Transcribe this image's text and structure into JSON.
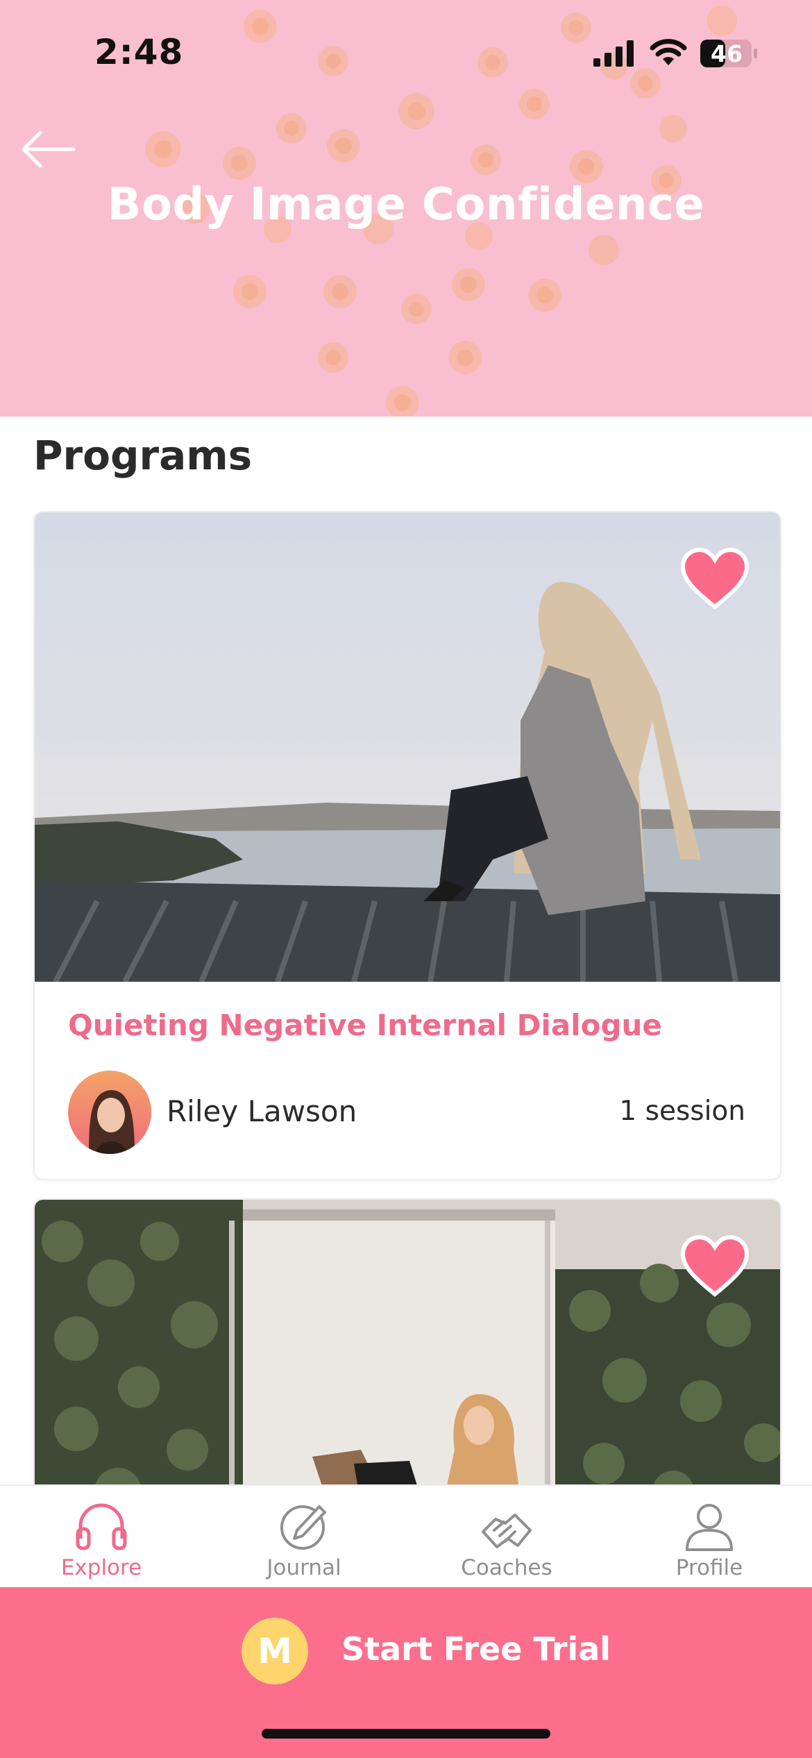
{
  "status_bar": {
    "time": "2:48",
    "battery": "46"
  },
  "header": {
    "title": "Body Image Confidence",
    "back_icon": "arrow-left-icon"
  },
  "section": {
    "title": "Programs"
  },
  "programs": [
    {
      "title": "Quieting Negative Internal Dialogue",
      "coach": "Riley Lawson",
      "sessions": "1 session",
      "favorited": true
    },
    {
      "favorited": true
    }
  ],
  "tabs": [
    {
      "label": "Explore",
      "icon": "headphones-icon",
      "active": true
    },
    {
      "label": "Journal",
      "icon": "pencil-circle-icon",
      "active": false
    },
    {
      "label": "Coaches",
      "icon": "handshake-icon",
      "active": false
    },
    {
      "label": "Profile",
      "icon": "person-icon",
      "active": false
    }
  ],
  "cta": {
    "label": "Start Free Trial",
    "logo_letter": "M"
  },
  "colors": {
    "accent": "#ee6b8b",
    "cta": "#fc6e8b",
    "header": "#f9bfd0",
    "logo": "#fdd56c"
  }
}
